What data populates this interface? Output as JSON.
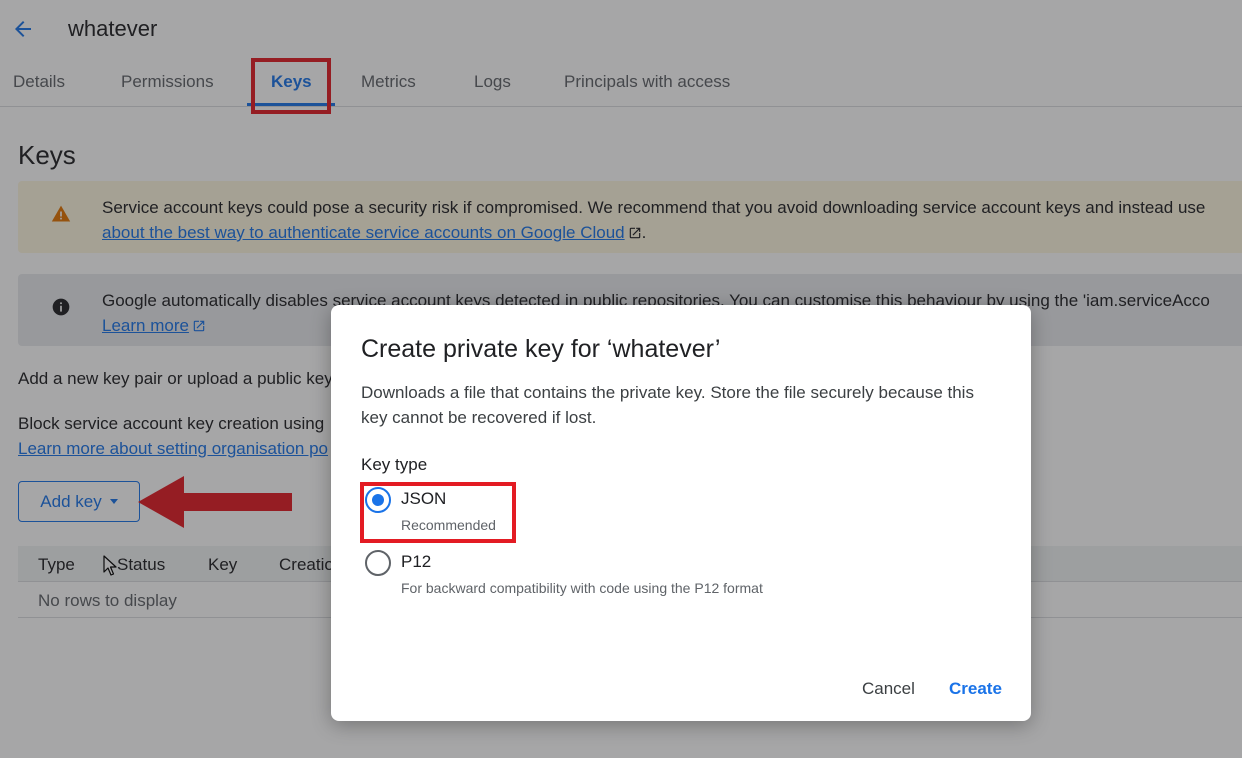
{
  "header": {
    "title": "whatever"
  },
  "tabs": [
    {
      "label": "Details"
    },
    {
      "label": "Permissions"
    },
    {
      "label": "Keys"
    },
    {
      "label": "Metrics"
    },
    {
      "label": "Logs"
    },
    {
      "label": "Principals with access"
    }
  ],
  "active_tab": "Keys",
  "main": {
    "heading": "Keys",
    "warning_banner": {
      "line1": "Service account keys could pose a security risk if compromised. We recommend that you avoid downloading service account keys and instead use",
      "link": "about the best way to authenticate service accounts on Google Cloud",
      "suffix": "."
    },
    "info_banner": {
      "line1": "Google automatically disables service account keys detected in public repositories. You can customise this behaviour by using the 'iam.serviceAcco",
      "link": "Learn more"
    },
    "add_key_text": "Add a new key pair or upload a public key",
    "block_text": "Block service account key creation using",
    "policy_link": "Learn more about setting organisation po",
    "add_key_button": "Add key",
    "table": {
      "columns": [
        "Type",
        "Status",
        "Key",
        "Creation"
      ],
      "empty_text": "No rows to display"
    }
  },
  "dialog": {
    "title": "Create private key for ‘whatever’",
    "description": "Downloads a file that contains the private key. Store the file securely because this key cannot be recovered if lost.",
    "key_type_label": "Key type",
    "options": [
      {
        "label": "JSON",
        "sublabel": "Recommended",
        "selected": true
      },
      {
        "label": "P12",
        "sublabel": "For backward compatibility with code using the P12 format",
        "selected": false
      }
    ],
    "cancel_label": "Cancel",
    "create_label": "Create"
  },
  "colors": {
    "accent": "#1a73e8",
    "annotation_red": "#e31b23",
    "warning_bg": "#fef7e0",
    "warning_icon": "#e37400"
  },
  "icons": {
    "back": "arrow-left-icon",
    "warning": "warning-triangle-icon",
    "info": "info-circle-icon",
    "external": "external-link-icon",
    "dropdown": "caret-down-icon",
    "cursor": "mouse-pointer-icon"
  }
}
